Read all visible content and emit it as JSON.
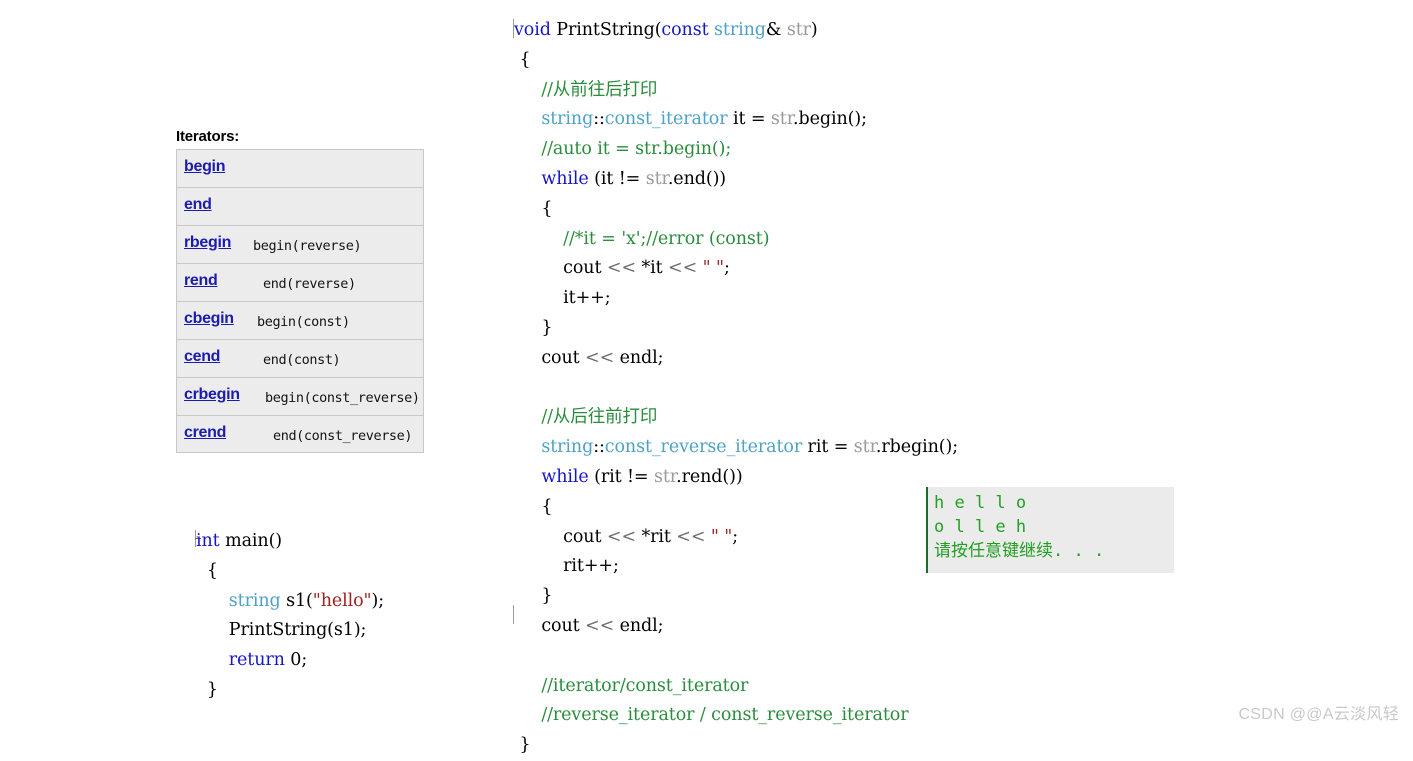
{
  "iterators_panel": {
    "title": "Iterators:",
    "rows": [
      {
        "name": "begin",
        "desc": ""
      },
      {
        "name": "end",
        "desc": ""
      },
      {
        "name": "rbegin",
        "desc": "begin(reverse)"
      },
      {
        "name": "rend",
        "desc": "end(reverse)"
      },
      {
        "name": "cbegin",
        "desc": "begin(const)"
      },
      {
        "name": "cend",
        "desc": "end(const)"
      },
      {
        "name": "crbegin",
        "desc": "begin(const_reverse)"
      },
      {
        "name": "crend",
        "desc": "end(const_reverse)"
      }
    ]
  },
  "code_print_string": {
    "lines": [
      "void PrintString(const string& str)",
      "{",
      "    //从前往后打印",
      "    string::const_iterator it = str.begin();",
      "    //auto it = str.begin();",
      "    while (it != str.end())",
      "    {",
      "        //*it = 'x';//error (const)",
      "        cout << *it << \" \";",
      "        it++;",
      "    }",
      "    cout << endl;",
      "",
      "    //从后往前打印",
      "    string::const_reverse_iterator rit = str.rbegin();",
      "    while (rit != str.rend())",
      "    {",
      "        cout << *rit << \" \";",
      "        rit++;",
      "    }",
      "    cout << endl;",
      "",
      "    //iterator/const_iterator",
      "    //reverse_iterator / const_reverse_iterator",
      "}"
    ]
  },
  "code_main": {
    "lines": [
      "int main()",
      "{",
      "    string s1(\"hello\");",
      "    PrintString(s1);",
      "    return 0;",
      "}"
    ]
  },
  "console": {
    "lines": [
      "h e l l o ",
      "o l l e h ",
      "请按任意键继续. . ."
    ],
    "text": "h e l l o \no l l e h \n请按任意键继续. . .",
    "text_color": "#21a021",
    "background": "#ebebeb"
  },
  "watermark": {
    "text": "CSDN @@A云淡风轻"
  },
  "colors": {
    "keyword": "#1616c8",
    "type": "#4ea2c4",
    "comment": "#2a8c3c",
    "string_literal": "#a02020",
    "gray_identifier": "#9a9a9a",
    "table_background": "#ececec",
    "link_blue": "#1b1bae"
  }
}
